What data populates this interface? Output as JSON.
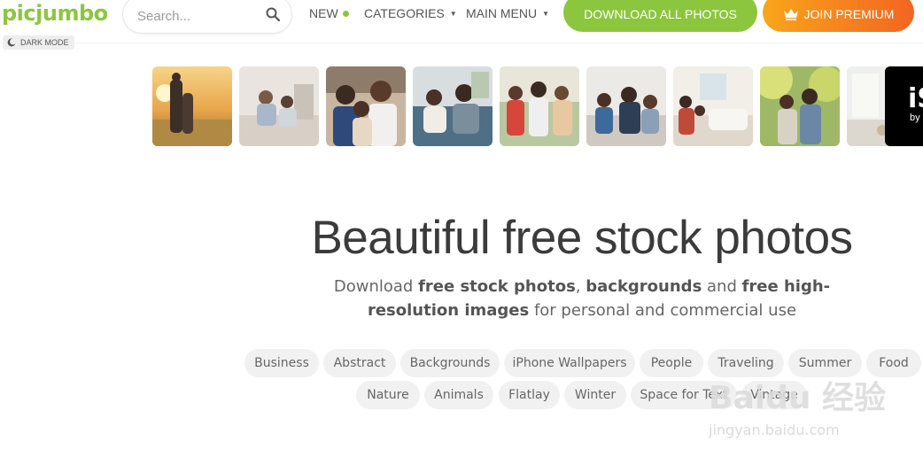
{
  "header": {
    "logo": "picjumbo",
    "search": {
      "placeholder": "Search..."
    },
    "nav": {
      "new": "NEW",
      "categories": "CATEGORIES",
      "main_menu": "MAIN MENU"
    },
    "download_all": "DOWNLOAD ALL PHOTOS",
    "join_premium": "JOIN PREMIUM",
    "dark_mode": "DARK MODE"
  },
  "colors": {
    "brand": "#8cc63f",
    "premium_start": "#f9a51a",
    "premium_end": "#f26522"
  },
  "photo_strip": {
    "items": [
      {
        "name": "family-sunset-photo"
      },
      {
        "name": "family-living-room-photo"
      },
      {
        "name": "family-smiling-photo"
      },
      {
        "name": "family-sofa-photo"
      },
      {
        "name": "family-outdoor-photo"
      },
      {
        "name": "family-group-photo"
      },
      {
        "name": "family-home-photo"
      },
      {
        "name": "family-park-photo"
      },
      {
        "name": "interior-photo"
      },
      {
        "name": "istock-banner",
        "text": "iS",
        "sub": "by"
      }
    ]
  },
  "hero": {
    "title": "Beautiful free stock photos",
    "sub_1": "Download ",
    "sub_2": "free stock photos",
    "sub_3": ", ",
    "sub_4": "backgrounds",
    "sub_5": " and ",
    "sub_6": "free high-resolution images",
    "sub_7": " for personal and commercial use"
  },
  "tags": [
    "Business",
    "Abstract",
    "Backgrounds",
    "iPhone Wallpapers",
    "People",
    "Traveling",
    "Summer",
    "Food",
    "Nature",
    "Animals",
    "Flatlay",
    "Winter",
    "Space for Text",
    "Vintage"
  ],
  "watermark": {
    "line1": "Baidu 经验",
    "line2": "jingyan.baidu.com"
  }
}
